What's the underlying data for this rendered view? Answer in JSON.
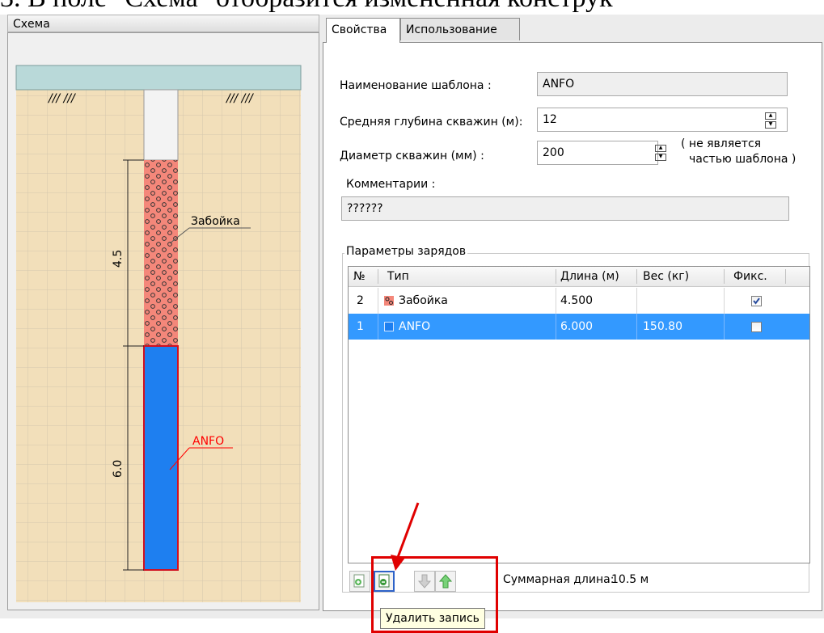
{
  "doc_heading": "3.     В поле \"Схема\" отобразится измененная конструк",
  "scheme_panel": {
    "title": "Схема",
    "ground_marks_left": "/// ///",
    "ground_marks_right": "/// ///",
    "stemming_label": "Забойка",
    "charge_label": "ANFO",
    "dim_top": "4.5",
    "dim_bottom": "6.0",
    "stemming_color": "#f4877a",
    "charge_color": "#1e7ff0",
    "marker_color": "#ff0000",
    "soil_color": "#f2dfba",
    "sky_color": "#b9d9d9"
  },
  "tabs": [
    {
      "label": "Свойства"
    },
    {
      "label": "Использование"
    }
  ],
  "form": {
    "template_name_label": "Наименование шаблона :",
    "template_name_value": "ANFO",
    "avg_depth_label": "Средняя глубина скважин (м):",
    "avg_depth_value": "12",
    "diameter_label": "Диаметр скважин (мм) :",
    "diameter_value": "200",
    "diameter_note_1": "( не является",
    "diameter_note_2": "частью шаблона )",
    "comments_label": "Комментарии :",
    "comments_value": "??????"
  },
  "charges": {
    "group_title": "Параметры зарядов",
    "columns": [
      "№",
      "Тип",
      "Длина (м)",
      "Вес (кг)",
      "Фикс."
    ],
    "rows": [
      {
        "num": "2",
        "type": "Забойка",
        "length": "4.500",
        "weight": "",
        "fixed": true,
        "icon": "stemming-swatch-icon",
        "selected": false
      },
      {
        "num": "1",
        "type": "ANFO",
        "length": "6.000",
        "weight": "150.80",
        "fixed": false,
        "icon": "anfo-swatch-icon",
        "selected": true
      }
    ],
    "total_label": "Суммарная длина:",
    "total_value": "10.5 м"
  },
  "toolbar": {
    "buttons": [
      "add-record-icon",
      "delete-record-icon",
      "move-down-icon",
      "move-up-icon"
    ]
  },
  "tooltip": "Удалить запись",
  "colors": {
    "selection": "#3399ff",
    "annotation_red": "#e00000"
  }
}
